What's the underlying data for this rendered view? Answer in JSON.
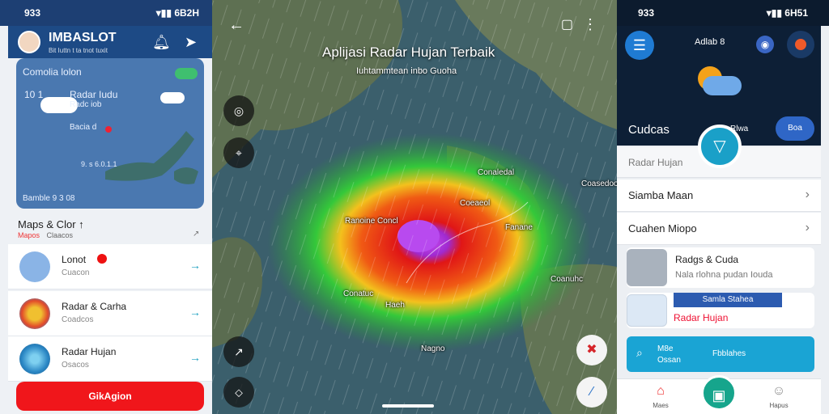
{
  "left": {
    "status_time": "933",
    "status_right": "▾▮▮ 6B2H",
    "app_title": "IMBASLOT",
    "app_subtitle": "Bit Iuttn t ta tnot tuxit",
    "card_title": "Comolia lolon",
    "card_temp": "10 1",
    "card_loc": "Radar Iudu",
    "card_line1": "Radc iob",
    "card_line2": "Bacia d",
    "card_coords": "9. s 6.0.1.1",
    "card_footer": "Bamble 9 3 08",
    "list_title": "Maps & Clor ↑",
    "list_sub": "Mapos",
    "list_sub2": "Claacos",
    "items": [
      {
        "label": "Lonot",
        "sub": "Cuacon"
      },
      {
        "label": "Radar & Carha",
        "sub": "Coadcos"
      },
      {
        "label": "Radar Hujan",
        "sub": "Osacos"
      }
    ],
    "button_label": "GikAgion"
  },
  "map": {
    "title": "Aplijasi Radar Hujan Terbaik",
    "subtitle": "Iuhtammtean inbo Guoha",
    "labels": [
      "Conaledal",
      "Coeaeol",
      "Ranoine Concl",
      "Fanane",
      "Coasedooe",
      "Coanuhc",
      "Conatuc",
      "Haeh",
      "Nagno"
    ],
    "colors": {
      "ocean": "#3b5f6c",
      "land": "#6c7a5a",
      "radar_green": "#2ec83a",
      "radar_red": "#e8201a",
      "radar_core": "#b03ad8"
    }
  },
  "right": {
    "status_time": "933",
    "status_right": "▾▮▮ 6H51",
    "header_label": "Adlab 8",
    "weather_title": "Cudcas",
    "weather_sub": "Rlwa",
    "pill_label": "Boa",
    "search_placeholder": "Radar Hujan",
    "menu": [
      "Siamba Maan",
      "Cuahen Miopo"
    ],
    "news1_title": "Radgs & Cuda",
    "news1_sub": "Nala rlohna pudan Iouda",
    "news2_bar": "Samla Stahea",
    "news2_title": "Radar Hujan",
    "cta_line1": "M8e",
    "cta_line2": "Ossan",
    "cta_line3": "Fbblahes",
    "nav_left": "Maes",
    "nav_right": "Hapus"
  }
}
